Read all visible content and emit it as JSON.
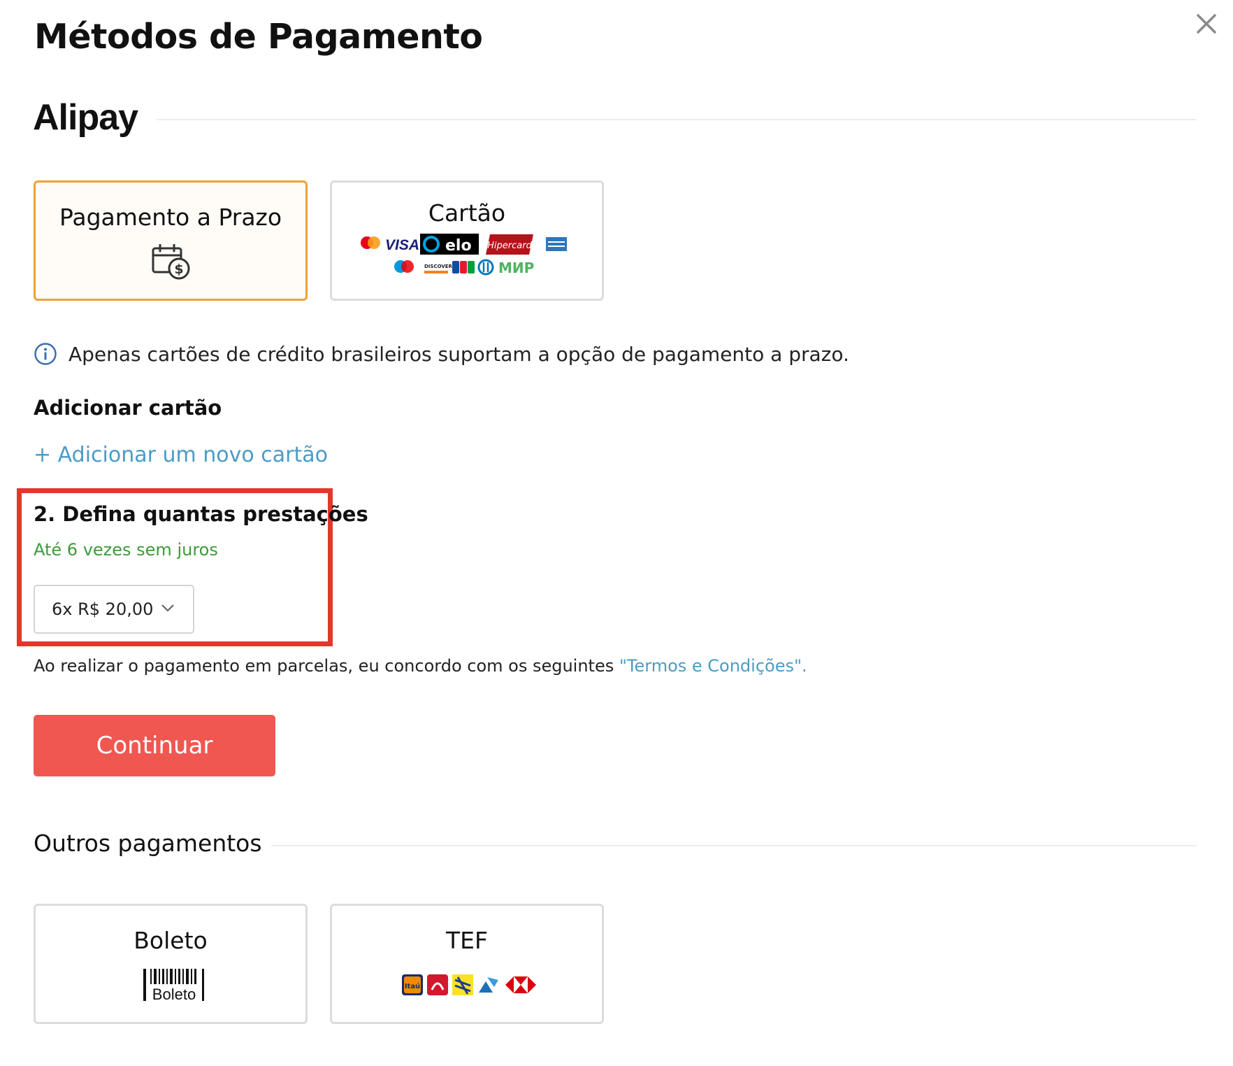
{
  "dialog": {
    "title": "Métodos de Pagamento",
    "close_icon": "close-icon"
  },
  "provider": {
    "name": "Alipay"
  },
  "methods": [
    {
      "label": "Pagamento a Prazo",
      "icon": "calendar-dollar-icon",
      "selected": true
    },
    {
      "label": "Cartão",
      "icon": "card-brands-logos",
      "selected": false,
      "brands": [
        "mastercard",
        "VISA",
        "elo",
        "Hipercard",
        "amex",
        "maestro",
        "DISCOVER",
        "JCB",
        "diners",
        "МИР"
      ]
    }
  ],
  "notice": {
    "icon": "info-icon",
    "text": "Apenas cartões de crédito brasileiros suportam a opção de pagamento a prazo."
  },
  "add_card": {
    "heading": "Adicionar cartão",
    "link": "+ Adicionar um novo cartão"
  },
  "installments": {
    "heading": "2. Defina quantas prestações",
    "subtitle": "Até 6 vezes sem juros",
    "selected": "6x R$ 20,00"
  },
  "agreement": {
    "text": "Ao realizar o pagamento em parcelas, eu concordo com os seguintes ",
    "link": "\"Termos e Condições\"."
  },
  "continue_button": "Continuar",
  "other": {
    "heading": "Outros pagamentos",
    "methods": [
      {
        "label": "Boleto",
        "icon": "boleto-barcode-icon",
        "icon_text": "Boleto"
      },
      {
        "label": "TEF",
        "icon": "bank-logos",
        "bank_text": "Itaú"
      }
    ]
  },
  "colors": {
    "accent_selected": "#f0a23a",
    "highlight_border": "#e4372b",
    "link": "#4a9cc6",
    "success_text": "#3d9a3a",
    "button": "#ef5750"
  }
}
